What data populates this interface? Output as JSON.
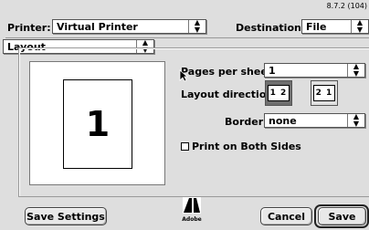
{
  "version": "8.7.2 (104)",
  "printer": {
    "label": "Printer:",
    "value": "Virtual Printer"
  },
  "destination": {
    "label": "Destination:",
    "value": "File"
  },
  "panel": {
    "value": "Layout"
  },
  "preview": {
    "page_number": "1"
  },
  "pages_per_sheet": {
    "label": "Pages per sheet:",
    "value": "1"
  },
  "layout_direction": {
    "label": "Layout direction:",
    "options": [
      {
        "label": "1 2",
        "selected": true
      },
      {
        "label": "2 1",
        "selected": false
      }
    ]
  },
  "border": {
    "label": "Border:",
    "value": "none"
  },
  "print_both_sides": {
    "label": "Print on Both Sides",
    "checked": false
  },
  "buttons": {
    "save_settings": "Save Settings",
    "cancel": "Cancel",
    "save": "Save"
  },
  "logo": {
    "text": "Adobe"
  }
}
